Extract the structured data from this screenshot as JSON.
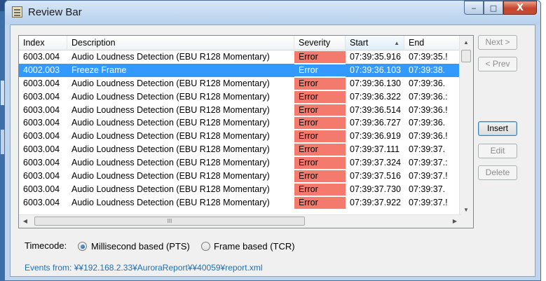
{
  "window": {
    "title": "Review Bar",
    "controls": {
      "minimize": "‒",
      "maximize": "□",
      "close": "X"
    }
  },
  "table": {
    "headers": {
      "index": "Index",
      "description": "Description",
      "severity": "Severity",
      "start": "Start",
      "end": "End"
    },
    "sorted_by": "Start",
    "rows": [
      {
        "index": "6003.004",
        "description": "Audio Loudness Detection (EBU R128 Momentary)",
        "severity": "Error",
        "start": "07:39:35.916",
        "end": "07:39:35.!",
        "selected": false
      },
      {
        "index": "4002.003",
        "description": "Freeze Frame",
        "severity": "Error",
        "start": "07:39:36.103",
        "end": "07:39:38.",
        "selected": true
      },
      {
        "index": "6003.004",
        "description": "Audio Loudness Detection (EBU R128 Momentary)",
        "severity": "Error",
        "start": "07:39:36.130",
        "end": "07:39:36.",
        "selected": false
      },
      {
        "index": "6003.004",
        "description": "Audio Loudness Detection (EBU R128 Momentary)",
        "severity": "Error",
        "start": "07:39:36.322",
        "end": "07:39:36.:",
        "selected": false
      },
      {
        "index": "6003.004",
        "description": "Audio Loudness Detection (EBU R128 Momentary)",
        "severity": "Error",
        "start": "07:39:36.514",
        "end": "07:39:36.!",
        "selected": false
      },
      {
        "index": "6003.004",
        "description": "Audio Loudness Detection (EBU R128 Momentary)",
        "severity": "Error",
        "start": "07:39:36.727",
        "end": "07:39:36.",
        "selected": false
      },
      {
        "index": "6003.004",
        "description": "Audio Loudness Detection (EBU R128 Momentary)",
        "severity": "Error",
        "start": "07:39:36.919",
        "end": "07:39:36.!",
        "selected": false
      },
      {
        "index": "6003.004",
        "description": "Audio Loudness Detection (EBU R128 Momentary)",
        "severity": "Error",
        "start": "07:39:37.111",
        "end": "07:39:37.",
        "selected": false
      },
      {
        "index": "6003.004",
        "description": "Audio Loudness Detection (EBU R128 Momentary)",
        "severity": "Error",
        "start": "07:39:37.324",
        "end": "07:39:37.:",
        "selected": false
      },
      {
        "index": "6003.004",
        "description": "Audio Loudness Detection (EBU R128 Momentary)",
        "severity": "Error",
        "start": "07:39:37.516",
        "end": "07:39:37.!",
        "selected": false
      },
      {
        "index": "6003.004",
        "description": "Audio Loudness Detection (EBU R128 Momentary)",
        "severity": "Error",
        "start": "07:39:37.730",
        "end": "07:39:37.",
        "selected": false
      },
      {
        "index": "6003.004",
        "description": "Audio Loudness Detection (EBU R128 Momentary)",
        "severity": "Error",
        "start": "07:39:37.922",
        "end": "07:39:37.!",
        "selected": false
      }
    ],
    "hscroll_thumb_label": "III"
  },
  "buttons": {
    "next": "Next >",
    "prev": "< Prev",
    "insert": "Insert",
    "edit": "Edit",
    "delete": "Delete"
  },
  "timecode": {
    "label": "Timecode:",
    "option_ms": "Millisecond based (PTS)",
    "option_frame": "Frame based (TCR)",
    "selected": "ms"
  },
  "events": {
    "label": "Events from:",
    "path": "¥¥192.168.2.33¥AuroraReport¥¥40059¥report.xml"
  },
  "colors": {
    "error_bg": "#f47a6e",
    "selection_bg": "#3399ff",
    "link": "#1e6fb5"
  }
}
